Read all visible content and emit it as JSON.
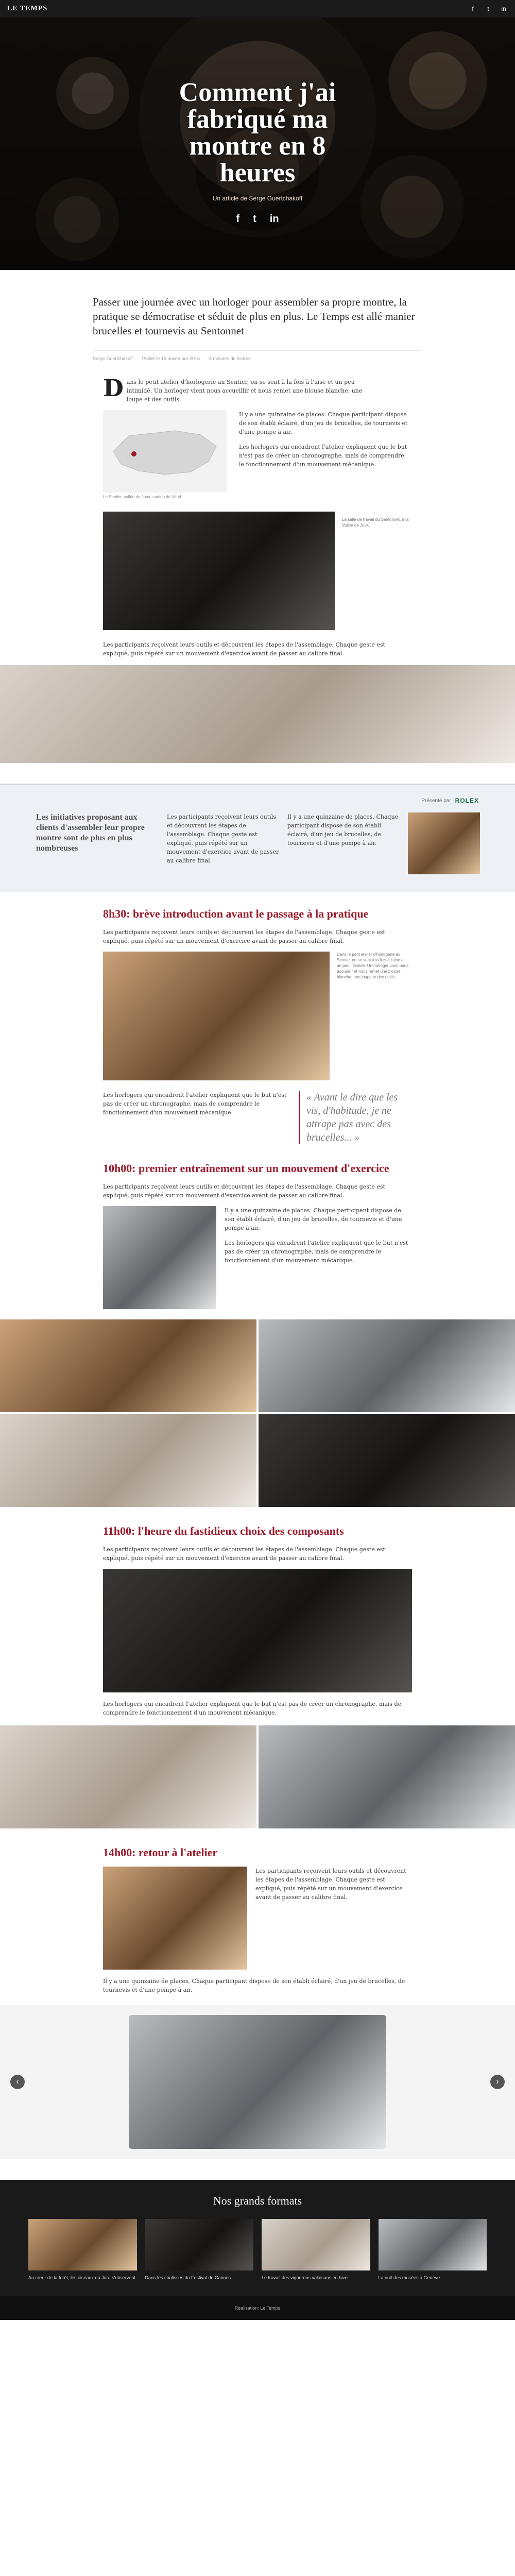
{
  "topbar": {
    "logo": "LE TEMPS",
    "icons": [
      "facebook-icon",
      "twitter-icon",
      "linkedin-icon"
    ]
  },
  "hero": {
    "title": "Comment j'ai fabriqué ma montre en 8 heures",
    "subtitle": "Un article de Serge Guertchakoff",
    "share": [
      "f",
      "t",
      "in"
    ]
  },
  "lead": "Passer une journée avec un horloger pour assembler sa propre montre, la pratique se démocratise et séduit de plus en plus. Le Temps est allé manier brucelles et tournevis au Sentonnet",
  "byline": [
    "Serge Guertchakoff",
    "Publié le 15 novembre 2016",
    "5 minutes de lecture"
  ],
  "intro_paragraphs": [
    "Dans le petit atelier d'horlogerie au Sentier, on se sent à la fois à l'aise et un peu intimidé. Un horloger vient nous accueillir et nous remet une blouse blanche, une loupe et des outils.",
    "Il y a une quinzaine de places. Chaque participant dispose de son établi éclairé, d'un jeu de brucelles, de tournevis et d'une pompe à air.",
    "Les horlogers qui encadrent l'atelier expliquent que le but n'est pas de créer un chronographe, mais de comprendre le fonctionnement d'un mouvement mécanique."
  ],
  "map_caption": "Le Sentier, vallée de Joux, canton de Vaud",
  "photo_caption_1": "La salle de travail du Sentonnet, à la Vallée de Joux.",
  "sponsor": {
    "label": "Présenté par",
    "brand": "ROLEX",
    "title": "Les initiatives proposant aux clients d'assembler leur propre montre sont de plus en plus nombreuses"
  },
  "sections": [
    {
      "heading": "8h30: brève introduction avant le passage à la pratique"
    },
    {
      "heading": "10h00: premier entraînement sur un mouvement d'exercice"
    },
    {
      "heading": "11h00: l'heure du fastidieux choix des composants"
    },
    {
      "heading": "14h00: retour à l'atelier"
    }
  ],
  "pull_quote": "« Avant le dire que les vis, d'habitude, je ne attrape pas avec des brucelles... »",
  "section_text": "Les participants reçoivent leurs outils et découvrent les étapes de l'assemblage. Chaque geste est expliqué, puis répété sur un mouvement d'exercice avant de passer au calibre final.",
  "formats": {
    "title": "Nos grands formats",
    "items": [
      "Au cœur de la forêt, les oiseaux du Jura s'observent",
      "Dans les coulisses du Festival de Cannes",
      "Le travail des vignerons valaisans en hiver",
      "La nuit des musées à Genève"
    ]
  },
  "footer": "Réalisation: Le Temps"
}
